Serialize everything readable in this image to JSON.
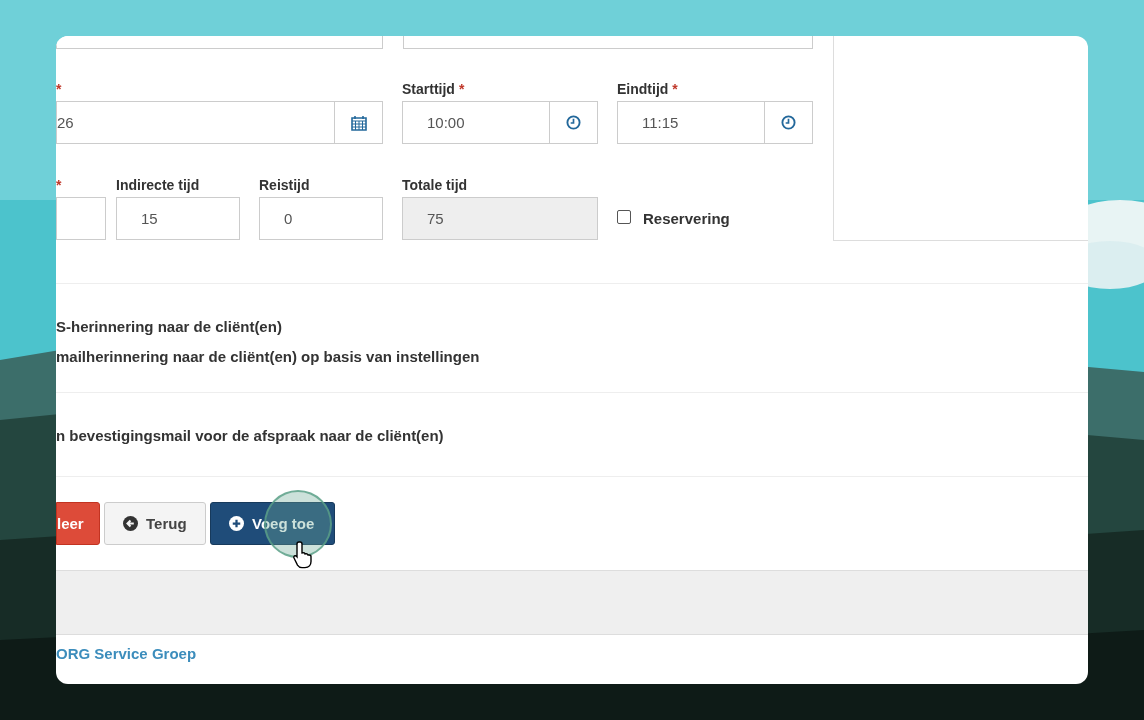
{
  "date_row": [
    {
      "kind": "date",
      "required_mark": "*",
      "value": "26"
    },
    {
      "kind": "time",
      "label": "Starttijd",
      "required_mark": "*",
      "value": "10:00"
    },
    {
      "kind": "time",
      "label": "Eindtijd",
      "required_mark": "*",
      "value": "11:15"
    }
  ],
  "duration_row": [
    {
      "kind": "number",
      "required_mark": "*"
    },
    {
      "kind": "number",
      "label": "Indirecte tijd",
      "value": "15"
    },
    {
      "kind": "number",
      "label": "Reistijd",
      "value": "0"
    },
    {
      "kind": "readonly",
      "label": "Totale tijd",
      "value": "75"
    }
  ],
  "reservation": {
    "label": "Reservering",
    "checked": false
  },
  "reminders": [
    "S-herinnering naar de cliënt(en)",
    "mailherinnering naar de cliënt(en) op basis van instellingen"
  ],
  "confirmation": "n bevestigingsmail voor de afspraak naar de cliënt(en)",
  "buttons": [
    {
      "kind": "danger",
      "label": "leer"
    },
    {
      "kind": "default",
      "label": "Terug"
    },
    {
      "kind": "primary",
      "label": "Voeg toe"
    }
  ],
  "footer": {
    "link": "ORG Service Groep"
  }
}
